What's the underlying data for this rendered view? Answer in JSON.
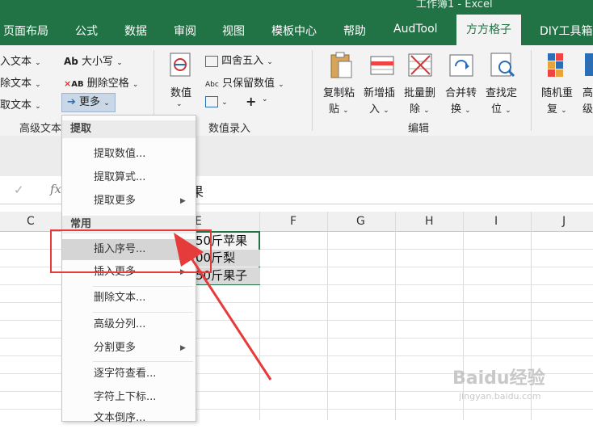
{
  "window": {
    "title": "工作簿1 - Excel"
  },
  "tabs": [
    "页面布局",
    "公式",
    "数据",
    "审阅",
    "视图",
    "模板中心",
    "帮助",
    "AudTool",
    "方方格子",
    "DIY工具箱"
  ],
  "active_tab": "方方格子",
  "ribbon": {
    "text_group": {
      "items_left": [
        "入文本",
        "除文本",
        "取文本"
      ],
      "items_right": [
        "大小写",
        "删除空格",
        "更多"
      ],
      "icon_labels": [
        "Ab",
        "AB"
      ],
      "label": "高级文本"
    },
    "numeric_group": {
      "button": "数值",
      "items": [
        "四舍五入",
        "只保留数值"
      ],
      "icon_label": "Abc",
      "label": "数值录入"
    },
    "edit_group": {
      "buttons": [
        {
          "line1": "复制粘",
          "line2": "贴"
        },
        {
          "line1": "新增插",
          "line2": "入"
        },
        {
          "line1": "批量删",
          "line2": "除"
        },
        {
          "line1": "合并转",
          "line2": "换"
        },
        {
          "line1": "查找定",
          "line2": "位"
        }
      ],
      "label": "编辑"
    },
    "random_group": {
      "buttons": [
        {
          "line1": "随机重",
          "line2": "复"
        },
        {
          "line1": "高",
          "line2": "级"
        }
      ]
    }
  },
  "formula_bar": {
    "content": "果"
  },
  "columns": [
    "C",
    "E",
    "F",
    "G",
    "H",
    "I",
    "J"
  ],
  "cells": [
    "50斤苹果",
    "00斤梨",
    "50斤果子"
  ],
  "menu": {
    "header1": "提取",
    "items_a": [
      "提取数值...",
      "提取算式...",
      "提取更多"
    ],
    "header2": "常用",
    "items_b": [
      "插入序号...",
      "插入更多",
      "删除文本...",
      "高级分列...",
      "分割更多",
      "逐字符查看...",
      "字符上下标...",
      "文本倒序..."
    ]
  },
  "watermark": {
    "text": "Baidu经验",
    "url": "jingyan.baidu.com"
  },
  "colors": {
    "excel_green": "#217346",
    "highlight_red": "#e63b3b"
  }
}
